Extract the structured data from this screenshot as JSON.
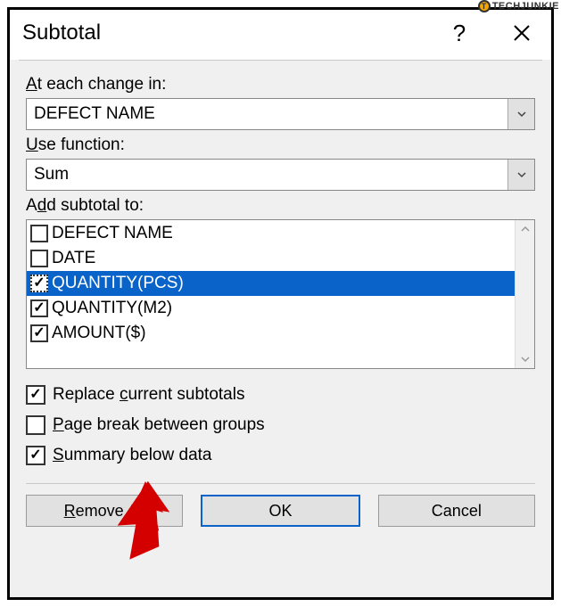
{
  "watermark": "TECHJUNKIE",
  "dialog": {
    "title": "Subtotal",
    "labels": {
      "change_in": "At each change in:",
      "use_function": "Use function:",
      "add_subtotal": "Add subtotal to:"
    },
    "combo_change": "DEFECT NAME",
    "combo_function": "Sum",
    "list": [
      {
        "label": "DEFECT NAME",
        "checked": false,
        "selected": false
      },
      {
        "label": "DATE",
        "checked": false,
        "selected": false
      },
      {
        "label": "QUANTITY(PCS)",
        "checked": true,
        "selected": true
      },
      {
        "label": "QUANTITY(M2)",
        "checked": true,
        "selected": false
      },
      {
        "label": "AMOUNT($)",
        "checked": true,
        "selected": false
      }
    ],
    "options": {
      "replace": {
        "label_pre": "Replace ",
        "u": "c",
        "label_post": "urrent subtotals",
        "checked": true
      },
      "pagebreak": {
        "u": "P",
        "label_post": "age break between groups",
        "checked": false
      },
      "summary": {
        "u": "S",
        "label_post": "ummary below data",
        "checked": true
      }
    },
    "buttons": {
      "remove": {
        "u": "R",
        "rest": "emove All"
      },
      "ok": "OK",
      "cancel": "Cancel"
    }
  }
}
